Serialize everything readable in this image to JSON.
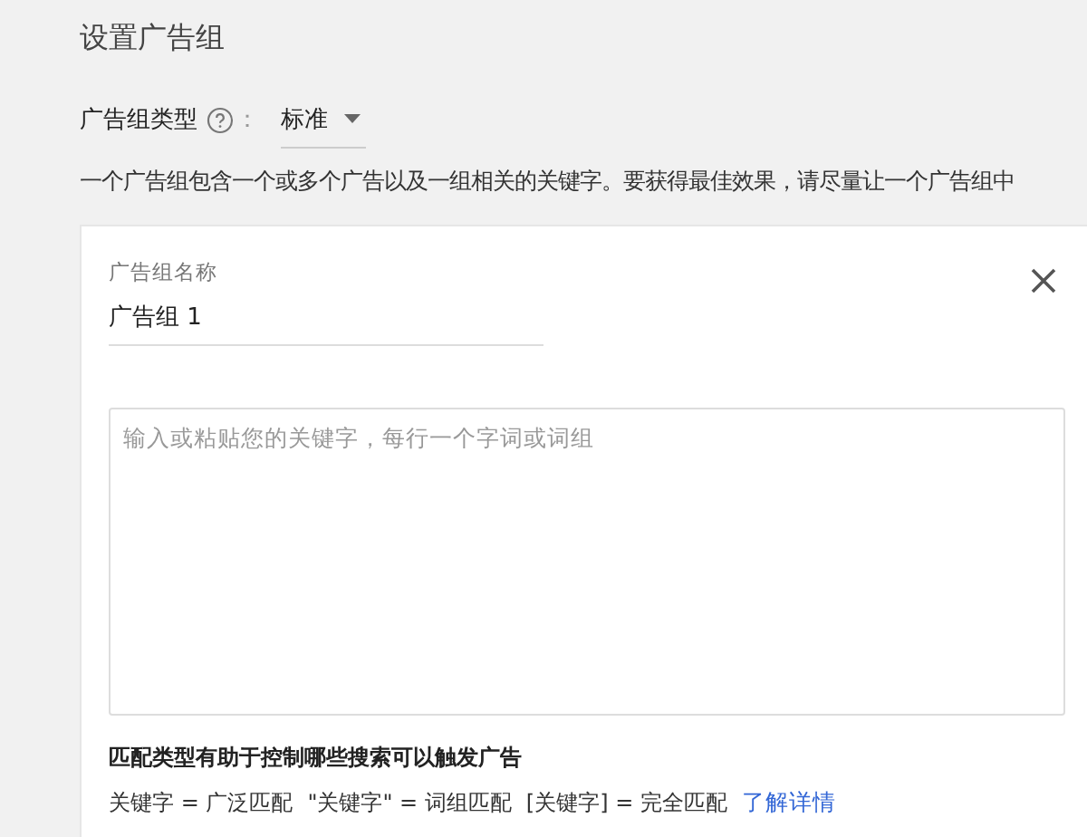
{
  "title": "设置广告组",
  "ad_group_type": {
    "label": "广告组类型",
    "separator": "：",
    "value": "标准"
  },
  "description": "一个广告组包含一个或多个广告以及一组相关的关键字。要获得最佳效果，请尽量让一个广告组中",
  "ad_group_card": {
    "name_field": {
      "label": "广告组名称",
      "value": "广告组 1"
    },
    "keywords_field": {
      "placeholder": "输入或粘贴您的关键字，每行一个字词或词组"
    },
    "match_heading": "匹配类型有助于控制哪些搜索可以触发广告",
    "match_types": [
      "关键字 = 广泛匹配",
      "\"关键字\" = 词组匹配",
      "[关键字] = 完全匹配"
    ],
    "learn_more_link": "了解详情"
  }
}
